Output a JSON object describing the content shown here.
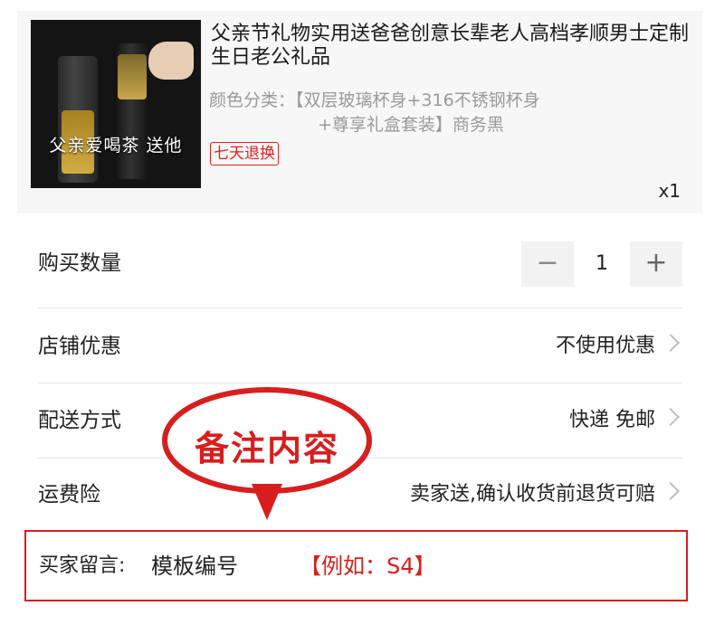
{
  "product": {
    "image_caption": "父亲爱喝茶 送他",
    "title": "父亲节礼物实用送爸爸创意长辈老人高档孝顺男士定制生日老公礼品",
    "variant_line1": "颜色分类：【双层玻璃杯身+316不锈钢杯身",
    "variant_line2": "+尊享礼盒套装】商务黑",
    "badge": "七天退换",
    "quantity_label": "x1"
  },
  "quantity_row": {
    "label": "购买数量",
    "minus": "−",
    "value": "1",
    "plus": "+"
  },
  "shop_discount": {
    "label": "店铺优惠",
    "value": "不使用优惠"
  },
  "delivery": {
    "label": "配送方式",
    "value": "快递 免邮"
  },
  "shipping_insurance": {
    "label": "运费险",
    "value": "卖家送,确认收货前退货可赔"
  },
  "callout": {
    "text": "备注内容"
  },
  "buyer_note": {
    "label": "买家留言:",
    "value": "模板编号",
    "hint": "【例如：S4】"
  },
  "colors": {
    "accent_red": "#d81e1e",
    "muted_text": "#9a9a9a",
    "card_bg": "#f7f7f7"
  },
  "icons": [
    "chevron-right-icon",
    "minus-icon",
    "plus-icon"
  ]
}
